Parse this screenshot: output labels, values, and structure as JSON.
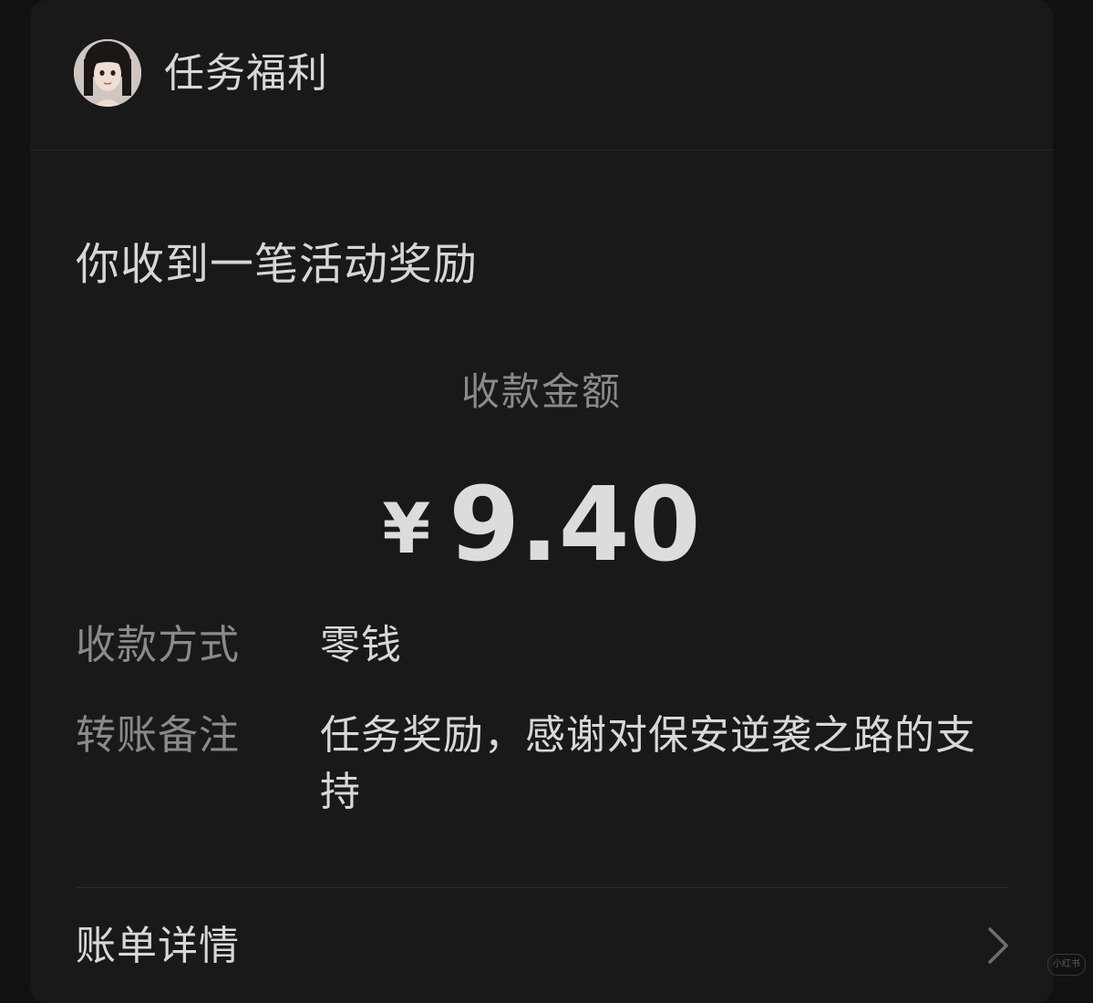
{
  "header": {
    "title": "任务福利"
  },
  "notice": "你收到一笔活动奖励",
  "amount": {
    "label": "收款金额",
    "currency": "¥",
    "value": "9.40"
  },
  "details": [
    {
      "label": "收款方式",
      "value": "零钱"
    },
    {
      "label": "转账备注",
      "value": "任务奖励，感谢对保安逆袭之路的支持"
    }
  ],
  "bill": {
    "label": "账单详情"
  },
  "colors": {
    "background": "#111111",
    "card": "#191919",
    "primary_text": "#d8d8d8",
    "secondary_text": "#8a8a8a"
  },
  "icons": [
    "avatar-image",
    "chevron-right-icon"
  ]
}
